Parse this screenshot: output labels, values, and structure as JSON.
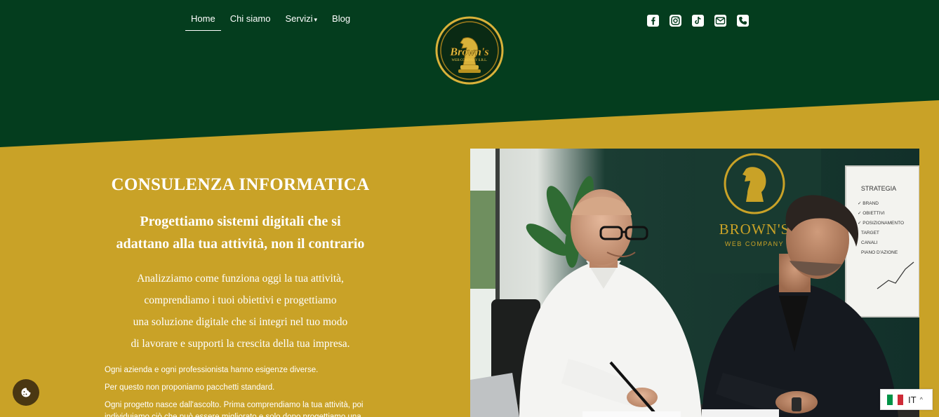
{
  "colors": {
    "header_bg": "#043d1e",
    "gold": "#c9a227",
    "white": "#ffffff"
  },
  "nav": {
    "items": [
      {
        "label": "Home",
        "active": true
      },
      {
        "label": "Chi siamo"
      },
      {
        "label": "Servizi",
        "dropdown": "▾"
      },
      {
        "label": "Blog"
      }
    ]
  },
  "logo": {
    "line1": "Brown's",
    "line2": "WEB COMPANY S.R.L."
  },
  "social": [
    "facebook-icon",
    "instagram-icon",
    "tiktok-icon",
    "mail-icon",
    "phone-icon"
  ],
  "hero": {
    "title": "CONSULENZA INFORMATICA",
    "subtitle_line1": "Progettiamo sistemi digitali che si",
    "subtitle_line2": "adattano alla tua attività, non il contrario",
    "para_lines": [
      "Analizziamo come funziona oggi la tua attività,",
      "comprendiamo i tuoi obiettivi e progettiamo",
      "una soluzione digitale che si integri nel tuo modo",
      "di lavorare e supporti la crescita della tua impresa."
    ],
    "small_1": "Ogni azienda e ogni professionista hanno esigenze diverse.",
    "small_2": "Per questo non proponiamo pacchetti standard.",
    "small_3": "Ogni progetto nasce dall'ascolto. Prima comprendiamo la tua attività, poi individuiamo ciò che può essere migliorato e solo dopo progettiamo una"
  },
  "photo": {
    "wall_brand_1": "BROWN'S",
    "wall_brand_2": "WEB COMPANY",
    "board_title": "STRATEGIA",
    "board_items": [
      "✓ BRAND",
      "✓ OBIETTIVI",
      "✓ POSIZIONAMENTO",
      "TARGET",
      "CANALI",
      "PIANO D'AZIONE"
    ]
  },
  "language": {
    "code": "IT",
    "chevron": "^"
  }
}
